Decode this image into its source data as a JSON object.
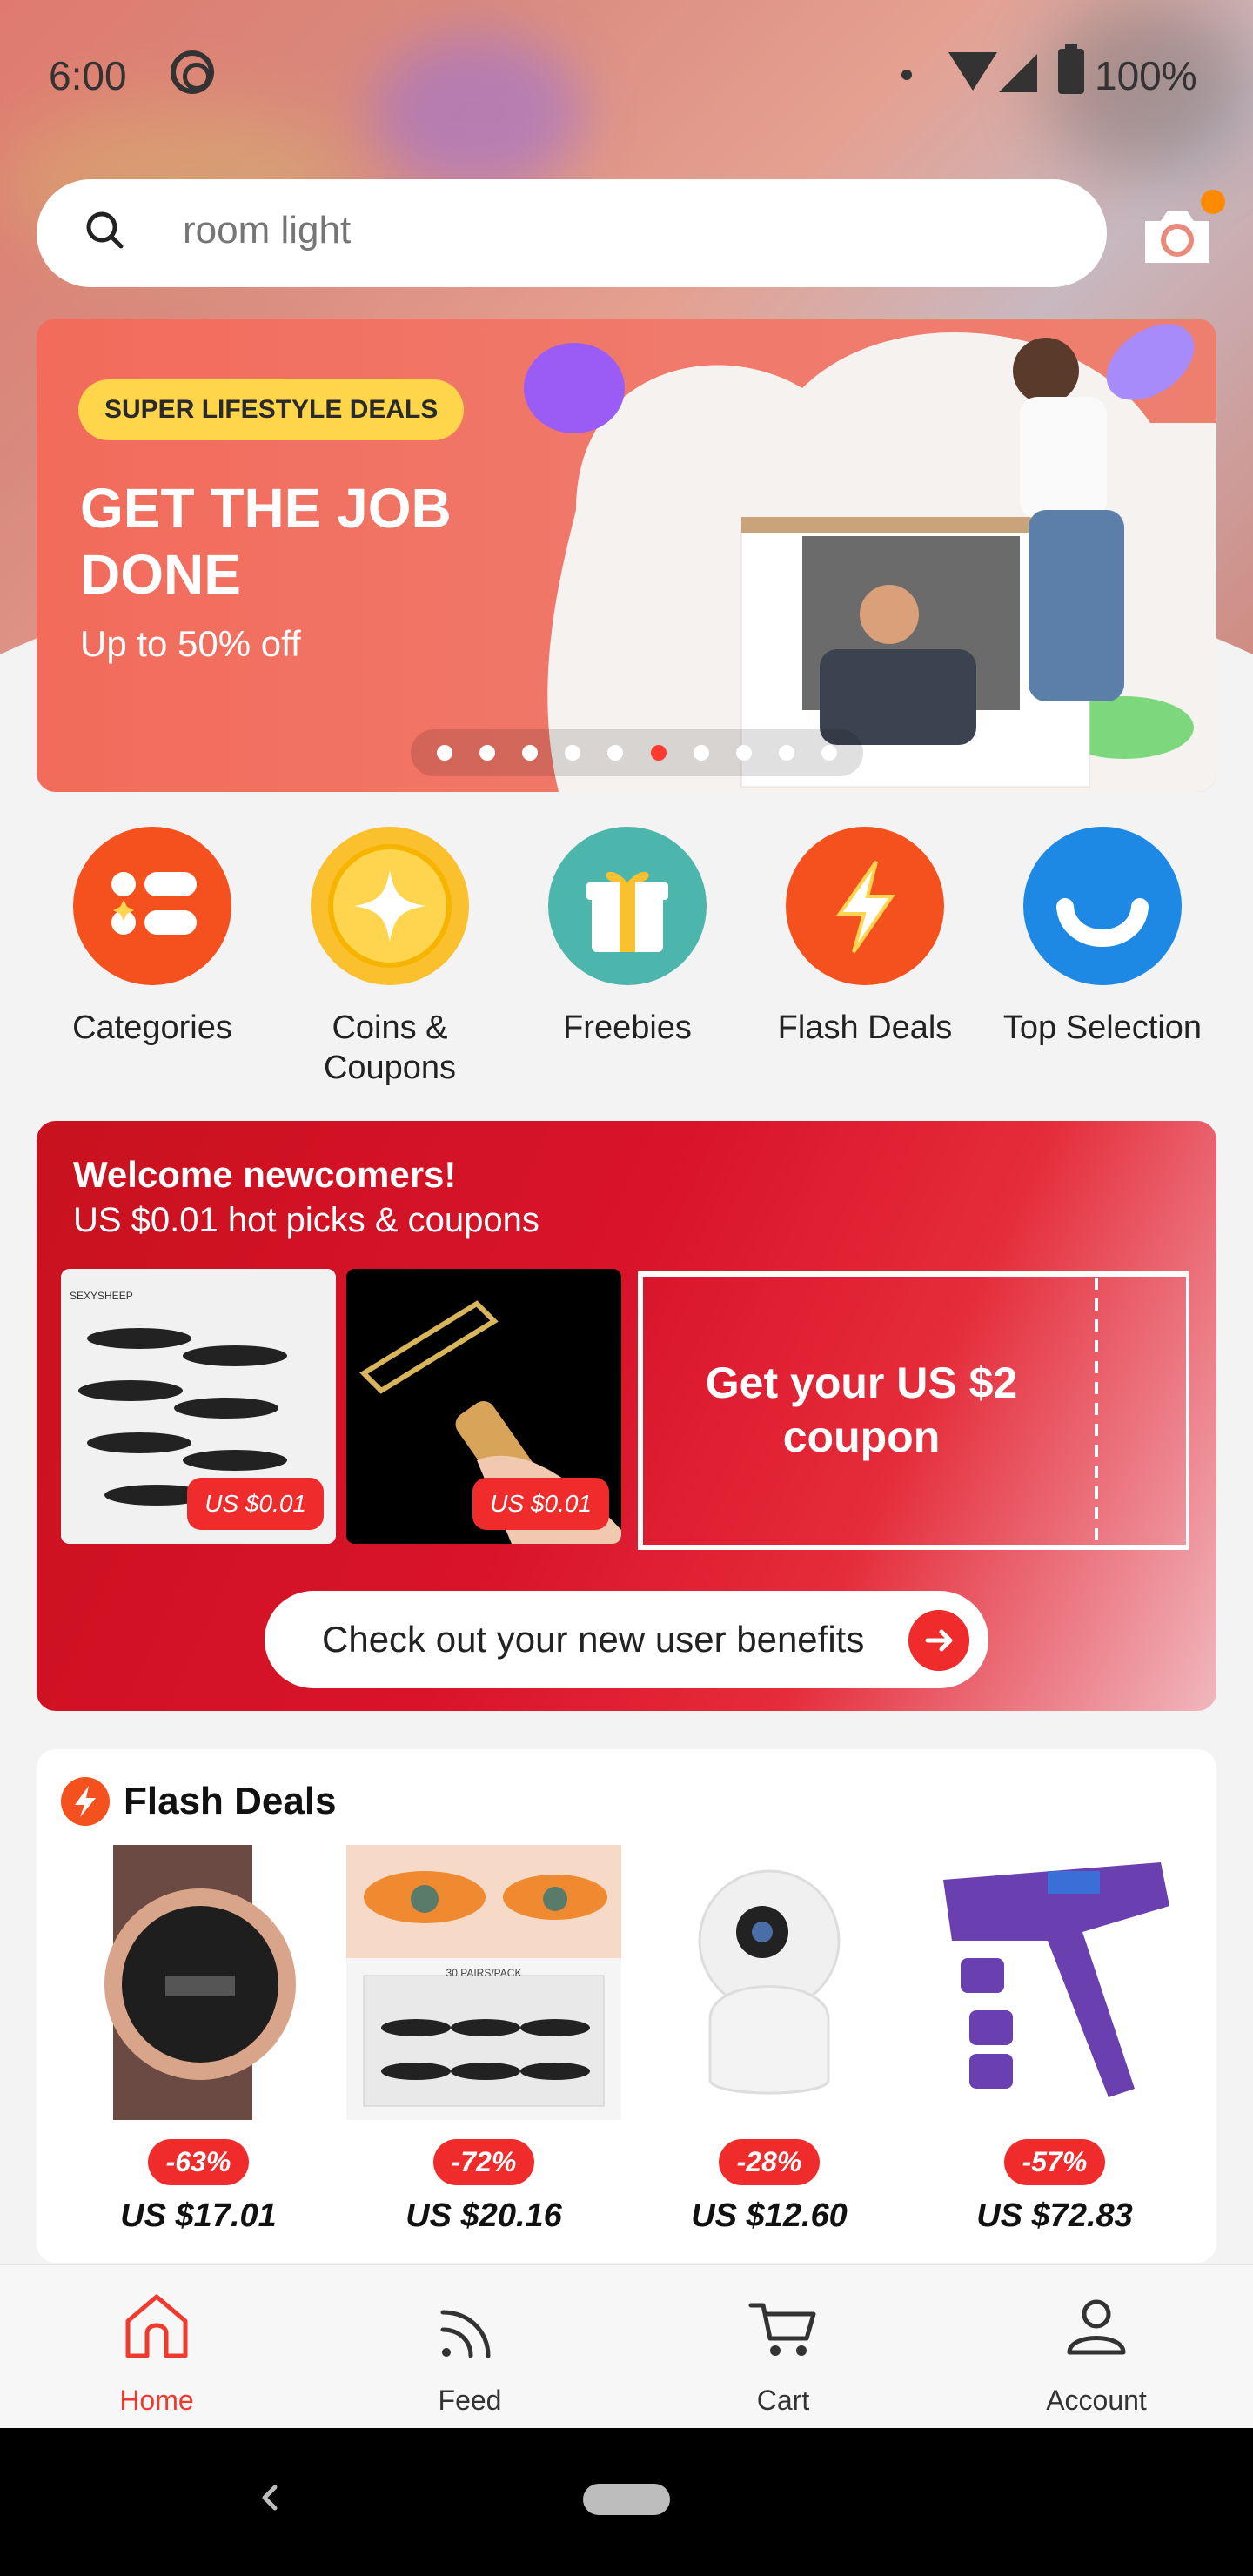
{
  "status_bar": {
    "time": "6:00",
    "battery": "100%"
  },
  "search": {
    "placeholder": "room light"
  },
  "hero": {
    "pill": "SUPER LIFESTYLE DEALS",
    "title": "GET THE JOB DONE",
    "subtitle": "Up to 50% off",
    "slide_count": 10,
    "active_slide": 6
  },
  "quick_links": [
    {
      "label": "Categories",
      "icon": "categories-icon",
      "color": "#f4511e"
    },
    {
      "label": "Coins & Coupons",
      "icon": "coins-icon",
      "color": "#fbc02d"
    },
    {
      "label": "Freebies",
      "icon": "gift-icon",
      "color": "#4db6ac"
    },
    {
      "label": "Flash Deals",
      "icon": "lightning-icon",
      "color": "#f4511e"
    },
    {
      "label": "Top Selection",
      "icon": "smile-icon",
      "color": "#1e88e5"
    }
  ],
  "welcome": {
    "title": "Welcome newcomers!",
    "subtitle": "US $0.01 hot picks & coupons",
    "products": [
      {
        "price": "US $0.01",
        "brand": "SEXYSHEEP"
      },
      {
        "price": "US $0.01"
      }
    ],
    "coupon": "Get your US $2 coupon",
    "cta": "Check out your new user benefits"
  },
  "flash_deals": {
    "title": "Flash Deals",
    "items": [
      {
        "discount": "-63%",
        "price": "US $17.01",
        "product": "watch"
      },
      {
        "discount": "-72%",
        "price": "US $20.16",
        "product": "eyelashes",
        "pack_text": "30 PAIRS/PACK"
      },
      {
        "discount": "-28%",
        "price": "US $12.60",
        "product": "camera"
      },
      {
        "discount": "-57%",
        "price": "US $72.83",
        "product": "ipl-device"
      }
    ]
  },
  "bottom_nav": [
    {
      "label": "Home",
      "active": true
    },
    {
      "label": "Feed",
      "active": false
    },
    {
      "label": "Cart",
      "active": false
    },
    {
      "label": "Account",
      "active": false
    }
  ],
  "colors": {
    "accent": "#ef3b2f",
    "brand_red": "#d9132a",
    "hero_bg": "#f26b5b",
    "pill": "#ffd64a"
  }
}
